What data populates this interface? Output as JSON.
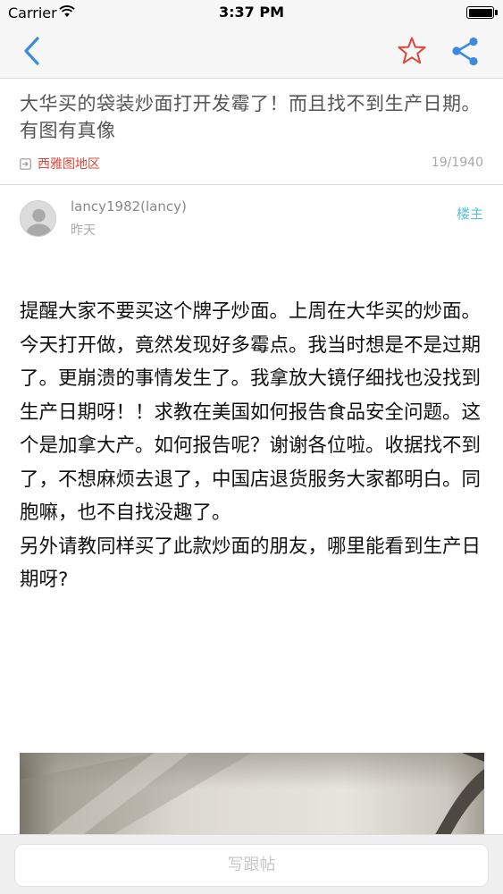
{
  "status_bar": {
    "carrier": "Carrier",
    "time": "3:37 PM",
    "battery_level": 1.0
  },
  "nav": {
    "back_icon": "chevron-left-icon",
    "favorite_icon": "star-outline-icon",
    "share_icon": "share-icon",
    "accent_color": "#3b8be0",
    "favorite_color": "#e0453a"
  },
  "post": {
    "title": "大华买的袋装炒面打开发霉了！而且找不到生产日期。有图有真像",
    "region": "西雅图地区",
    "counts": "19/1940",
    "author": "lancy1982(lancy)",
    "time": "昨天",
    "op_tag": "楼主",
    "body": [
      "提醒大家不要买这个牌子炒面。上周在大华买的炒面。今天打开做，竟然发现好多霉点。我当时想是不是过期了。更崩溃的事情发生了。我拿放大镜仔细找也没找到生产日期呀！！求教在美国如何报告食品安全问题。这个是加拿大产。如何报告呢？谢谢各位啦。收据找不到了，不想麻烦去退了，中国店退货服务大家都明白。同胞嘛，也不自找没趣了。",
      "另外请教同样买了此款炒面的朋友，哪里能看到生产日期呀?"
    ]
  },
  "reply": {
    "label": "写跟帖"
  }
}
